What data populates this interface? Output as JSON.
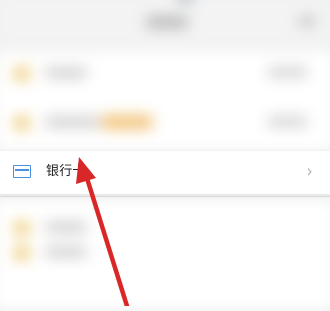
{
  "settings_row": {
    "label": "银行卡",
    "icon": "bank-card-icon",
    "chevron_icon": "chevron-right-icon",
    "icon_color": "#4a90e2"
  },
  "annotation": {
    "icon": "pointer-arrow-icon",
    "color": "#d92626"
  }
}
